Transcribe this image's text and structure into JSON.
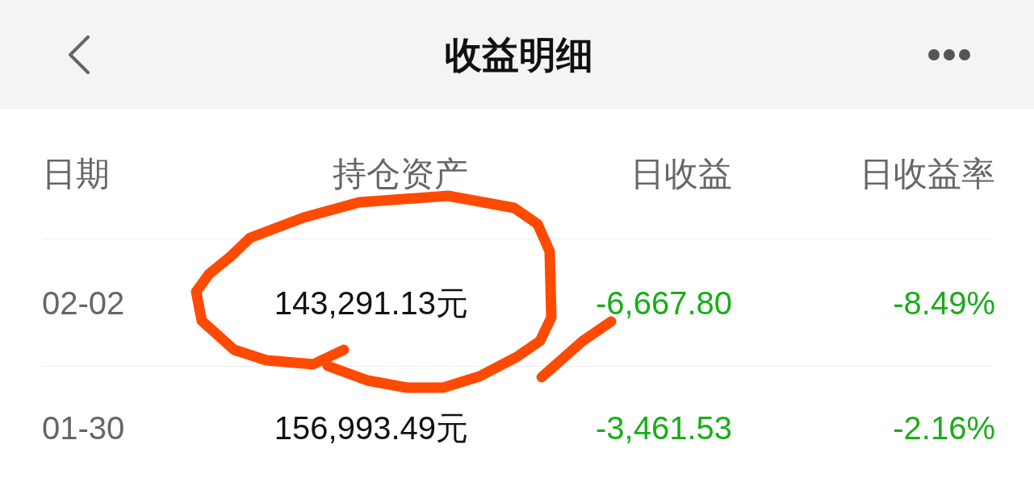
{
  "nav": {
    "title": "收益明细"
  },
  "table": {
    "columns": [
      "日期",
      "持仓资产",
      "日收益",
      "日收益率"
    ],
    "rows": [
      {
        "date": "02-02",
        "assets": "143,291.13元",
        "daily_gain": "-6,667.80",
        "daily_rate": "-8.49%",
        "loss": true
      },
      {
        "date": "01-30",
        "assets": "156,993.49元",
        "daily_gain": "-3,461.53",
        "daily_rate": "-2.16%",
        "loss": true
      }
    ]
  }
}
